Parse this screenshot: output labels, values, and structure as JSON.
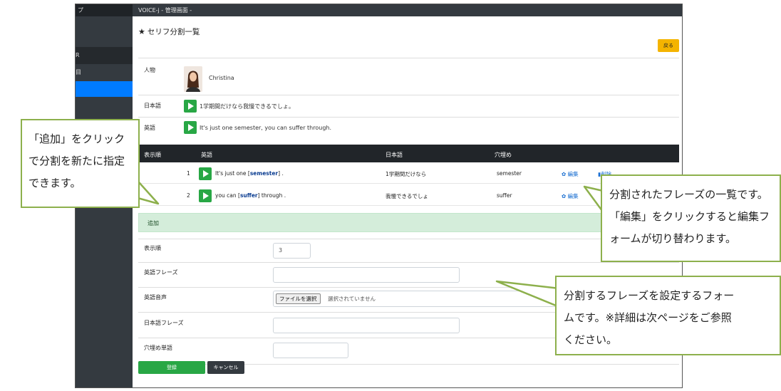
{
  "window": {
    "sidebar_header_label": "プ",
    "title": "VOICE-j - 管理画面 -"
  },
  "sidebar": {
    "items": [
      "",
      "R",
      "目",
      ""
    ]
  },
  "page": {
    "title": "セリフ分割一覧",
    "star_icon": "star-icon",
    "back_button": "戻る"
  },
  "character": {
    "label": "人物",
    "name": "Christina"
  },
  "sentence": {
    "japanese_label": "日本語",
    "japanese_text": "1学期間だけなら我慢できるでしょ。",
    "english_label": "英語",
    "english_text": "It's just one semester, you can suffer through."
  },
  "table": {
    "headers": [
      "表示順",
      "英語",
      "日本語",
      "穴埋め",
      ""
    ],
    "rows": [
      {
        "order": "1",
        "english_before": "It's just one [",
        "keyword": "semester",
        "english_after": "] .",
        "japanese": "1学期間だけなら",
        "blank": "semester",
        "edit": "編集",
        "delete": "削除"
      },
      {
        "order": "2",
        "english_before": "you can [",
        "keyword": "suffer",
        "english_after": "] through .",
        "japanese": "我慢できるでしょ",
        "blank": "suffer",
        "edit": "編集",
        "delete": ""
      }
    ]
  },
  "add_form": {
    "header": "追加",
    "order_label": "表示順",
    "order_value": "3",
    "english_phrase_label": "英語フレーズ",
    "english_phrase_value": "",
    "english_audio_label": "英語音声",
    "file_button": "ファイルを選択",
    "file_status": "選択されていません",
    "japanese_phrase_label": "日本語フレーズ",
    "japanese_phrase_value": "",
    "blank_word_label": "穴埋め単語",
    "blank_word_value": "",
    "submit_button": "登録",
    "cancel_button": "キャンセル"
  },
  "callouts": {
    "left": [
      "「追加」をクリック",
      "で分割を新たに指定",
      "できます。"
    ],
    "right_top": [
      "分割されたフレーズの一覧です。",
      "「編集」をクリックすると編集フ",
      "ォームが切り替わります。"
    ],
    "right_bottom": [
      "分割するフレーズを設定するフォー",
      "ムです。※詳細は次ページをご参照",
      "ください。"
    ]
  },
  "colors": {
    "accent_green": "#28a745",
    "callout_border": "#8db04c",
    "sidebar_dark": "#343a40",
    "active_blue": "#007bff",
    "back_button_yellow": "#f4b400"
  }
}
